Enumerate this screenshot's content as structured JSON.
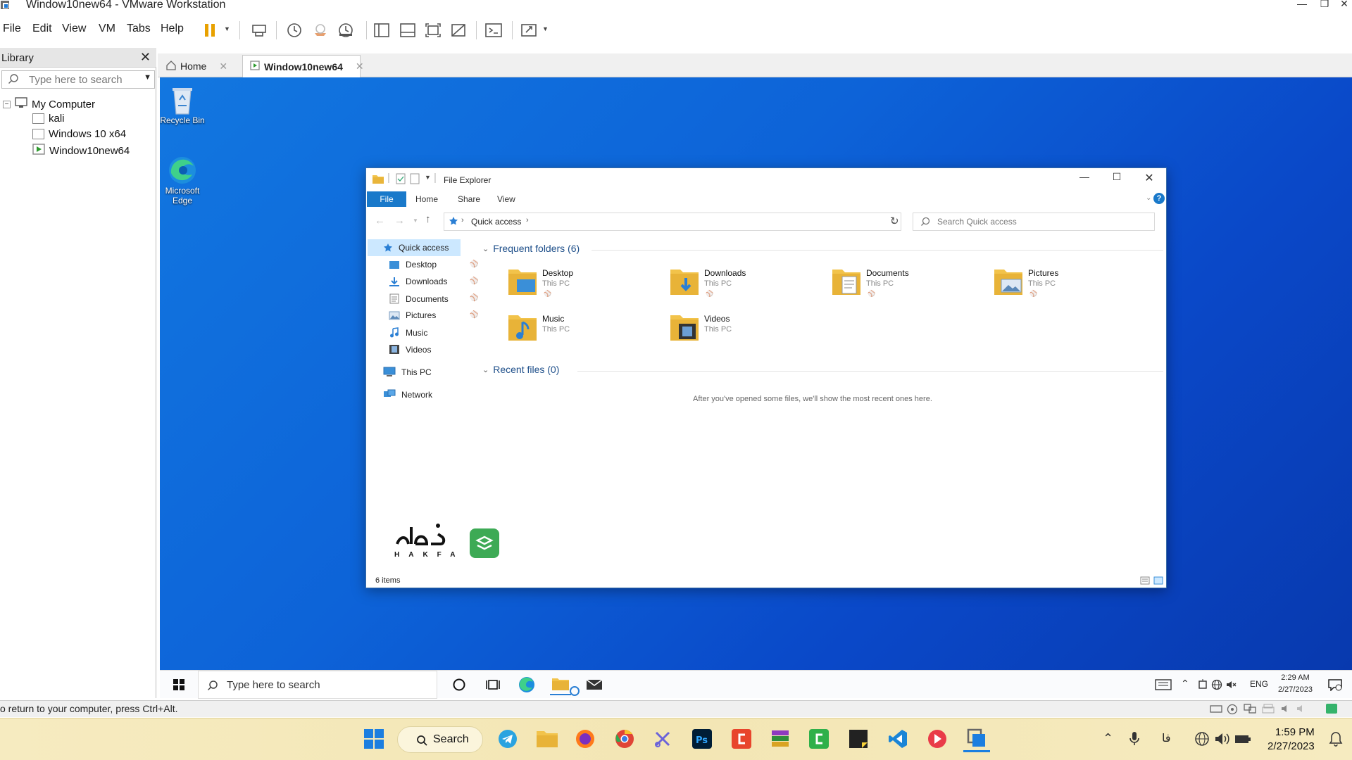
{
  "vmware": {
    "window_title": "Window10new64 - VMware Workstation",
    "menu": [
      "File",
      "Edit",
      "View",
      "VM",
      "Tabs",
      "Help"
    ]
  },
  "library": {
    "title": "Library",
    "search_placeholder": "Type here to search",
    "root": "My Computer",
    "items": [
      "kali",
      "Windows 10 x64",
      "Window10new64"
    ]
  },
  "tabs": [
    {
      "label": "Home",
      "active": false
    },
    {
      "label": "Window10new64",
      "active": true
    }
  ],
  "guest_desktop": {
    "icons": [
      {
        "label": "Recycle Bin",
        "icon": "recycle-bin-icon"
      },
      {
        "label": "Microsoft Edge",
        "icon": "edge-icon"
      }
    ]
  },
  "explorer": {
    "title": "File Explorer",
    "ribbon_tabs": [
      "File",
      "Home",
      "Share",
      "View"
    ],
    "address": "Quick access",
    "search_placeholder": "Search Quick access",
    "nav": {
      "quick_access": "Quick access",
      "pinned": [
        "Desktop",
        "Downloads",
        "Documents",
        "Pictures"
      ],
      "unpinned": [
        "Music",
        "Videos"
      ],
      "this_pc": "This PC",
      "network": "Network"
    },
    "frequent_header": "Frequent folders (6)",
    "folders": [
      {
        "name": "Desktop",
        "location": "This PC",
        "pinned": true
      },
      {
        "name": "Downloads",
        "location": "This PC",
        "pinned": true
      },
      {
        "name": "Documents",
        "location": "This PC",
        "pinned": true
      },
      {
        "name": "Pictures",
        "location": "This PC",
        "pinned": true
      },
      {
        "name": "Music",
        "location": "This PC",
        "pinned": false
      },
      {
        "name": "Videos",
        "location": "This PC",
        "pinned": false
      }
    ],
    "recent_header": "Recent files (0)",
    "recent_empty": "After you've opened some files, we'll show the most recent ones here.",
    "status": "6 items",
    "watermark": "HAKFA"
  },
  "guest_taskbar": {
    "search_placeholder": "Type here to search",
    "lang": "ENG",
    "time": "2:29 AM",
    "date": "2/27/2023"
  },
  "vm_status": "o return to your computer, press Ctrl+Alt.",
  "host_taskbar": {
    "search_label": "Search",
    "lang": "فا",
    "time": "1:59 PM",
    "date": "2/27/2023"
  },
  "colors": {
    "desktop_blue": "#0d63d8",
    "ribbon_file": "#1979ca",
    "host_taskbar": "#f3e6b4",
    "pause_orange": "#e8a100"
  }
}
